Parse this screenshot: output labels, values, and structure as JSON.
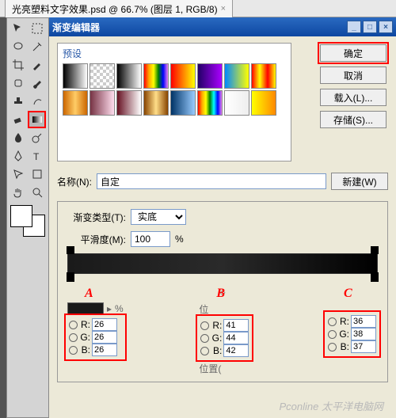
{
  "tab": {
    "filename": "光亮塑料文字效果.psd @ 66.7% (图层 1, RGB/8)"
  },
  "dialog": {
    "title": "渐变编辑器",
    "presets_label": "预设",
    "buttons": {
      "ok": "确定",
      "cancel": "取消",
      "load": "载入(L)...",
      "save": "存储(S)..."
    },
    "name_label": "名称(N):",
    "name_value": "自定",
    "new_btn": "新建(W)",
    "type_label": "渐变类型(T):",
    "type_value": "实底",
    "smooth_label": "平滑度(M):",
    "smooth_value": "100",
    "percent": "%",
    "pos_short": "位",
    "pos_label": "位置("
  },
  "marks": {
    "a": "A",
    "b": "B",
    "c": "C"
  },
  "rgb": {
    "a": {
      "r": "26",
      "g": "26",
      "b": "26"
    },
    "b": {
      "r": "41",
      "g": "44",
      "b": "42"
    },
    "c": {
      "r": "36",
      "g": "38",
      "b": "37"
    }
  },
  "presets": [
    "linear-gradient(90deg,#000,#fff)",
    "repeating-conic-gradient(#ccc 0 25%,#fff 0 50%) 0/8px 8px",
    "linear-gradient(90deg,#000,#fff)",
    "linear-gradient(90deg,red,orange,yellow,green,blue,violet)",
    "linear-gradient(90deg,red,yellow)",
    "linear-gradient(90deg,#206,#a0f)",
    "linear-gradient(90deg,#08f,#ff0)",
    "linear-gradient(90deg,red,yellow,red,yellow)",
    "linear-gradient(90deg,#c60,#fc6,#c60)",
    "linear-gradient(90deg,#734,#fde)",
    "linear-gradient(90deg,#612,#fff)",
    "linear-gradient(90deg,#840,#fd8,#840)",
    "linear-gradient(90deg,#036,#9cf)",
    "linear-gradient(90deg,red,orange,yellow,green,cyan,blue,violet)",
    "linear-gradient(90deg,#fff,#eee)",
    "linear-gradient(90deg,#ff0,#f80)"
  ],
  "watermark": "Pconline 太平洋电脑网"
}
